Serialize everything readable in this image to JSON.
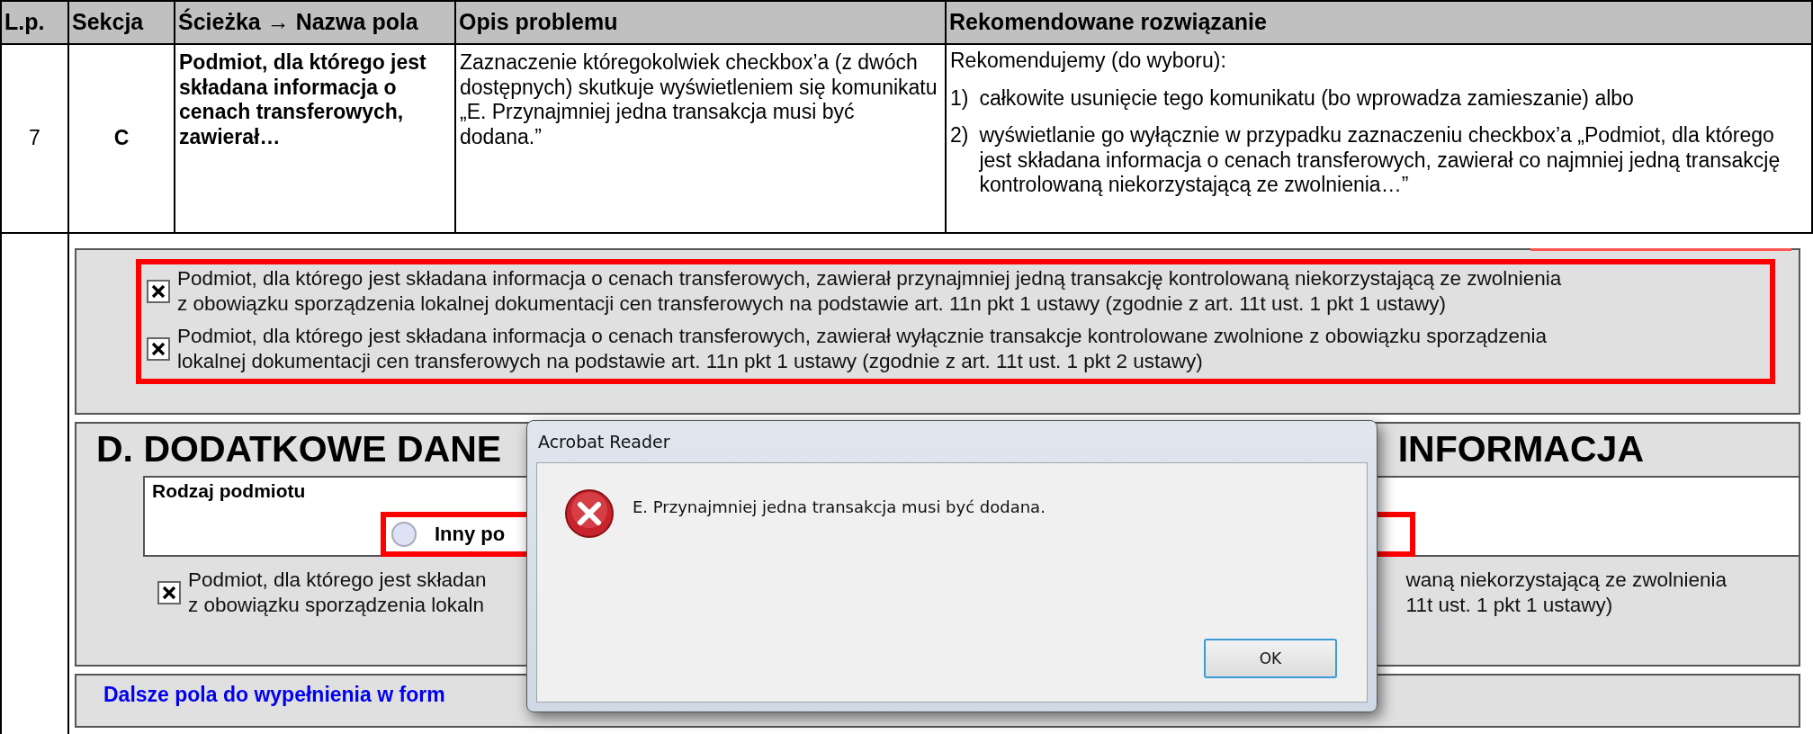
{
  "table": {
    "columns": [
      "L.p.",
      "Sekcja",
      "Ścieżka → Nazwa pola",
      "Opis problemu",
      "Rekomendowane rozwiązanie"
    ],
    "rows": [
      {
        "lp": "7",
        "section": "C",
        "path": "Podmiot, dla którego jest składana informacja o cenach transferowych, zawierał…",
        "problem": "Zaznaczenie któregokolwiek checkbox’a (z dwóch dostępnych) skutkuje wyświetleniem się komunikatu „E. Przynajmniej jedna transakcja musi być dodana.”",
        "solution": {
          "intro": "Rekomendujemy (do wyboru):",
          "items": [
            {
              "number": "1)",
              "text": "całkowite usunięcie tego komunikatu (bo wprowadza zamieszanie) albo"
            },
            {
              "number": "2)",
              "text": "wyświetlanie go wyłącznie w przypadku zaznaczeniu checkbox’a „Podmiot, dla którego jest składana informacja o cenach transferowych, zawierał co najmniej jedną transakcję kontrolowaną niekorzystającą ze zwolnienia…”"
            }
          ]
        }
      }
    ]
  },
  "screenshot": {
    "section_c": {
      "checkboxes": [
        {
          "checked": true,
          "lines": [
            "Podmiot, dla którego jest składana informacja o cenach transferowych, zawierał przynajmniej jedną transakcję kontrolowaną niekorzystającą ze zwolnienia",
            "z obowiązku sporządzenia lokalnej dokumentacji cen transferowych na podstawie art. 11n pkt 1 ustawy (zgodnie z art. 11t ust. 1 pkt 1 ustawy)"
          ]
        },
        {
          "checked": true,
          "lines": [
            "Podmiot, dla którego jest składana informacja o cenach transferowych, zawierał wyłącznie transakcje kontrolowane zwolnione z obowiązku sporządzenia",
            "lokalnej dokumentacji cen transferowych na podstawie art. 11n pkt 1 ustawy (zgodnie z art. 11t ust. 1 pkt 2 ustawy)"
          ]
        }
      ]
    },
    "section_d": {
      "heading_left": "D. DODATKOWE DANE",
      "heading_right": "INFORMACJA",
      "field_label": "Rodzaj podmiotu",
      "radio": {
        "label": "Inny po",
        "selected": false
      },
      "checkbox": {
        "checked": true,
        "left_lines": [
          "Podmiot, dla którego jest składan",
          "z obowiązku sporządzenia lokaln"
        ],
        "right_lines": [
          "waną niekorzystającą ze zwolnienia",
          "11t ust. 1 pkt 1 ustawy)"
        ]
      }
    },
    "footer_text": "Dalsze pola do wypełnienia w form",
    "dialog": {
      "title": "Acrobat Reader",
      "message": "E. Przynajmniej jedna transakcja musi być dodana.",
      "button": "OK"
    }
  }
}
